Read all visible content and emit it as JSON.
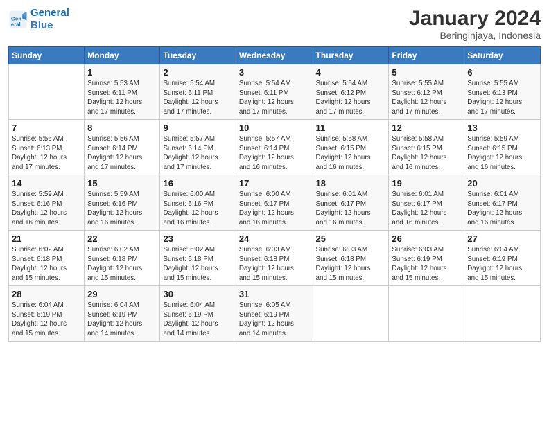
{
  "header": {
    "logo_line1": "General",
    "logo_line2": "Blue",
    "month_year": "January 2024",
    "location": "Beringinjaya, Indonesia"
  },
  "days_header": [
    "Sunday",
    "Monday",
    "Tuesday",
    "Wednesday",
    "Thursday",
    "Friday",
    "Saturday"
  ],
  "weeks": [
    [
      {
        "day": "",
        "info": ""
      },
      {
        "day": "1",
        "info": "Sunrise: 5:53 AM\nSunset: 6:11 PM\nDaylight: 12 hours\nand 17 minutes."
      },
      {
        "day": "2",
        "info": "Sunrise: 5:54 AM\nSunset: 6:11 PM\nDaylight: 12 hours\nand 17 minutes."
      },
      {
        "day": "3",
        "info": "Sunrise: 5:54 AM\nSunset: 6:11 PM\nDaylight: 12 hours\nand 17 minutes."
      },
      {
        "day": "4",
        "info": "Sunrise: 5:54 AM\nSunset: 6:12 PM\nDaylight: 12 hours\nand 17 minutes."
      },
      {
        "day": "5",
        "info": "Sunrise: 5:55 AM\nSunset: 6:12 PM\nDaylight: 12 hours\nand 17 minutes."
      },
      {
        "day": "6",
        "info": "Sunrise: 5:55 AM\nSunset: 6:13 PM\nDaylight: 12 hours\nand 17 minutes."
      }
    ],
    [
      {
        "day": "7",
        "info": "Sunrise: 5:56 AM\nSunset: 6:13 PM\nDaylight: 12 hours\nand 17 minutes."
      },
      {
        "day": "8",
        "info": "Sunrise: 5:56 AM\nSunset: 6:14 PM\nDaylight: 12 hours\nand 17 minutes."
      },
      {
        "day": "9",
        "info": "Sunrise: 5:57 AM\nSunset: 6:14 PM\nDaylight: 12 hours\nand 17 minutes."
      },
      {
        "day": "10",
        "info": "Sunrise: 5:57 AM\nSunset: 6:14 PM\nDaylight: 12 hours\nand 16 minutes."
      },
      {
        "day": "11",
        "info": "Sunrise: 5:58 AM\nSunset: 6:15 PM\nDaylight: 12 hours\nand 16 minutes."
      },
      {
        "day": "12",
        "info": "Sunrise: 5:58 AM\nSunset: 6:15 PM\nDaylight: 12 hours\nand 16 minutes."
      },
      {
        "day": "13",
        "info": "Sunrise: 5:59 AM\nSunset: 6:15 PM\nDaylight: 12 hours\nand 16 minutes."
      }
    ],
    [
      {
        "day": "14",
        "info": "Sunrise: 5:59 AM\nSunset: 6:16 PM\nDaylight: 12 hours\nand 16 minutes."
      },
      {
        "day": "15",
        "info": "Sunrise: 5:59 AM\nSunset: 6:16 PM\nDaylight: 12 hours\nand 16 minutes."
      },
      {
        "day": "16",
        "info": "Sunrise: 6:00 AM\nSunset: 6:16 PM\nDaylight: 12 hours\nand 16 minutes."
      },
      {
        "day": "17",
        "info": "Sunrise: 6:00 AM\nSunset: 6:17 PM\nDaylight: 12 hours\nand 16 minutes."
      },
      {
        "day": "18",
        "info": "Sunrise: 6:01 AM\nSunset: 6:17 PM\nDaylight: 12 hours\nand 16 minutes."
      },
      {
        "day": "19",
        "info": "Sunrise: 6:01 AM\nSunset: 6:17 PM\nDaylight: 12 hours\nand 16 minutes."
      },
      {
        "day": "20",
        "info": "Sunrise: 6:01 AM\nSunset: 6:17 PM\nDaylight: 12 hours\nand 16 minutes."
      }
    ],
    [
      {
        "day": "21",
        "info": "Sunrise: 6:02 AM\nSunset: 6:18 PM\nDaylight: 12 hours\nand 15 minutes."
      },
      {
        "day": "22",
        "info": "Sunrise: 6:02 AM\nSunset: 6:18 PM\nDaylight: 12 hours\nand 15 minutes."
      },
      {
        "day": "23",
        "info": "Sunrise: 6:02 AM\nSunset: 6:18 PM\nDaylight: 12 hours\nand 15 minutes."
      },
      {
        "day": "24",
        "info": "Sunrise: 6:03 AM\nSunset: 6:18 PM\nDaylight: 12 hours\nand 15 minutes."
      },
      {
        "day": "25",
        "info": "Sunrise: 6:03 AM\nSunset: 6:18 PM\nDaylight: 12 hours\nand 15 minutes."
      },
      {
        "day": "26",
        "info": "Sunrise: 6:03 AM\nSunset: 6:19 PM\nDaylight: 12 hours\nand 15 minutes."
      },
      {
        "day": "27",
        "info": "Sunrise: 6:04 AM\nSunset: 6:19 PM\nDaylight: 12 hours\nand 15 minutes."
      }
    ],
    [
      {
        "day": "28",
        "info": "Sunrise: 6:04 AM\nSunset: 6:19 PM\nDaylight: 12 hours\nand 15 minutes."
      },
      {
        "day": "29",
        "info": "Sunrise: 6:04 AM\nSunset: 6:19 PM\nDaylight: 12 hours\nand 14 minutes."
      },
      {
        "day": "30",
        "info": "Sunrise: 6:04 AM\nSunset: 6:19 PM\nDaylight: 12 hours\nand 14 minutes."
      },
      {
        "day": "31",
        "info": "Sunrise: 6:05 AM\nSunset: 6:19 PM\nDaylight: 12 hours\nand 14 minutes."
      },
      {
        "day": "",
        "info": ""
      },
      {
        "day": "",
        "info": ""
      },
      {
        "day": "",
        "info": ""
      }
    ]
  ]
}
